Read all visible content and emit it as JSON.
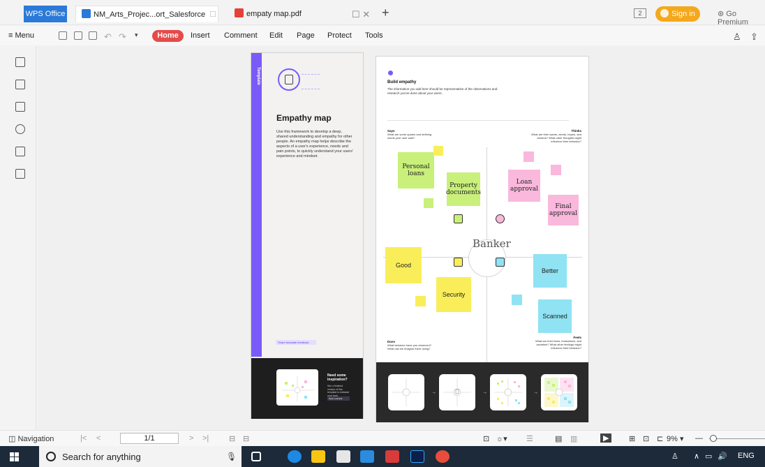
{
  "tabs": {
    "wps_label": "WPS Office",
    "doc1_label": "NM_Arts_Projec...ort_Salesforce",
    "doc2_label": "empaty map.pdf",
    "badge": "2",
    "signin": "Sign in",
    "go_premium": "Go Premium"
  },
  "menu": {
    "menu_label": "Menu",
    "home": "Home",
    "insert": "Insert",
    "comment": "Comment",
    "edit": "Edit",
    "page": "Page",
    "protect": "Protect",
    "tools": "Tools"
  },
  "page1": {
    "band_label": "Template",
    "title": "Empathy map",
    "body": "Use this framework to develop a deep, shared understanding and empathy for other people. An empathy map helps describe the aspects of a user's experience, needs and pain points, to quickly understand your users' experience and mindset.",
    "link": "Share template feedback",
    "dark_title": "Need some inspiration?",
    "dark_body": "See a finished version of this template to kickstart your work.",
    "dark_button": "Open example"
  },
  "page2": {
    "heading": "Build empathy",
    "subheading": "The information you add here should be representative of the observations and research you've done about your users.",
    "says_title": "Says",
    "says_body": "What are some quotes and defining words your user said?",
    "thinks_title": "Thinks",
    "thinks_body": "What are their wants, needs, hopes, and dreams? What other thoughts might influence their behavior?",
    "does_title": "Does",
    "does_body": "What behavior have you observed? What can we imagine them doing?",
    "feels_title": "Feels",
    "feels_body": "What are their fears, frustrations, and anxieties? What other feelings might influence their behavior?",
    "center": "Banker",
    "notes": {
      "personal_loans": "Personal loans",
      "property_documents": "Property documents",
      "loan_approval": "Loan approval",
      "final_approval": "Final approval",
      "good": "Good",
      "security": "Security",
      "better": "Better",
      "scanned": "Scanned"
    }
  },
  "status": {
    "navigation": "Navigation",
    "page": "1/1",
    "zoom": "9%"
  },
  "taskbar": {
    "search": "Search for anything",
    "lang": "ENG"
  },
  "colors": {
    "accent_purple": "#7a5af8",
    "home_red": "#e54b4b",
    "signin_orange": "#f4a81b",
    "note_green": "#c9f07a",
    "note_pink": "#f9b8dc",
    "note_yellow": "#f9ee5a",
    "note_cyan": "#8fe3f3"
  }
}
